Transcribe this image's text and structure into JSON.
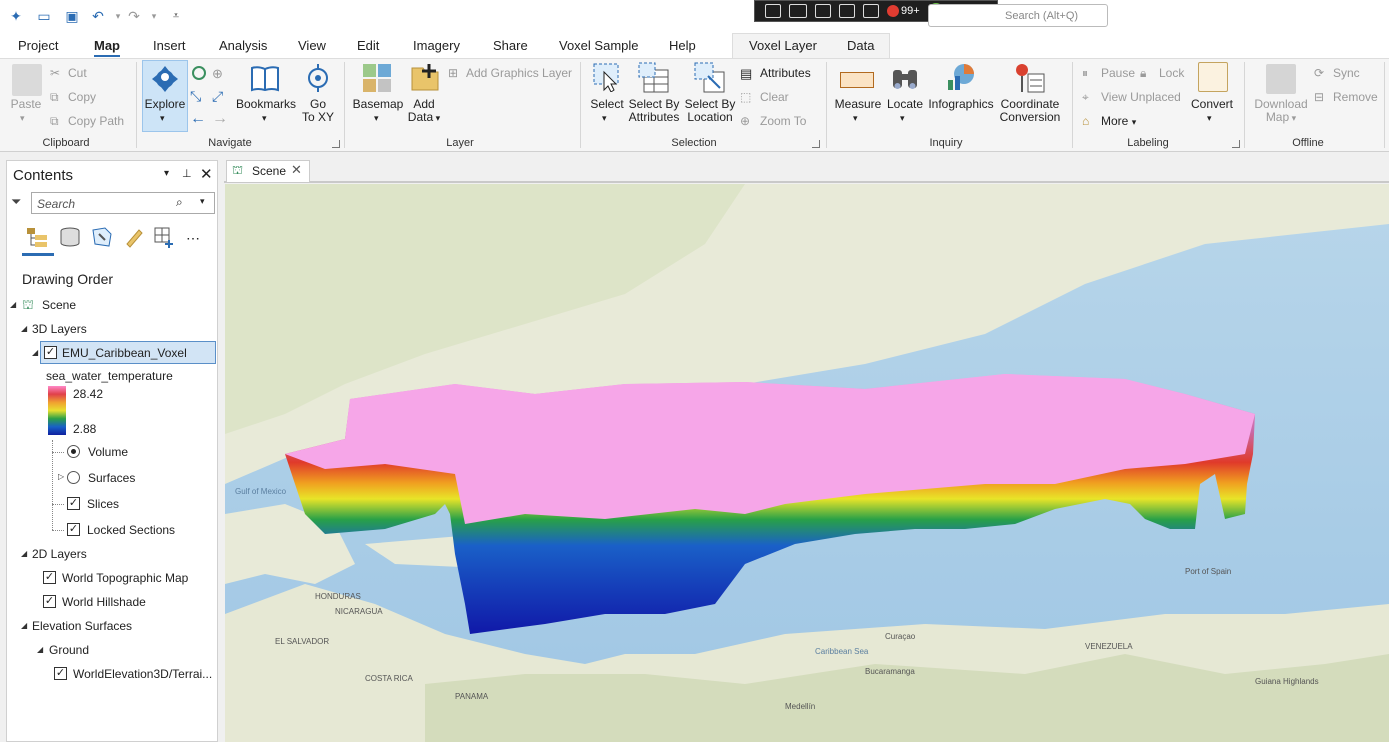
{
  "command_search": {
    "placeholder": "Search (Alt+Q)"
  },
  "status": {
    "notifications": "99+"
  },
  "tabs": [
    "Project",
    "Map",
    "Insert",
    "Analysis",
    "View",
    "Edit",
    "Imagery",
    "Share",
    "Voxel Sample",
    "Help"
  ],
  "context_tabs": [
    "Voxel Layer",
    "Data"
  ],
  "ribbon": {
    "clipboard": {
      "label": "Clipboard",
      "paste": "Paste",
      "cut": "Cut",
      "copy": "Copy",
      "copy_path": "Copy Path"
    },
    "navigate": {
      "label": "Navigate",
      "explore": "Explore",
      "bookmarks": "Bookmarks",
      "goto_xy_1": "Go",
      "goto_xy_2": "To XY"
    },
    "layer": {
      "label": "Layer",
      "basemap": "Basemap",
      "add_data_1": "Add",
      "add_data_2": "Data",
      "add_graphics": "Add Graphics Layer"
    },
    "selection": {
      "label": "Selection",
      "select": "Select",
      "select_by_attr_1": "Select By",
      "select_by_attr_2": "Attributes",
      "select_by_loc_1": "Select By",
      "select_by_loc_2": "Location",
      "attributes": "Attributes",
      "clear": "Clear",
      "zoom_to": "Zoom To"
    },
    "inquiry": {
      "label": "Inquiry",
      "measure": "Measure",
      "locate": "Locate",
      "infographics": "Infographics",
      "coord_1": "Coordinate",
      "coord_2": "Conversion"
    },
    "labeling": {
      "label": "Labeling",
      "pause": "Pause",
      "lock": "Lock",
      "view_unplaced": "View Unplaced",
      "more": "More",
      "convert": "Convert"
    },
    "offline": {
      "label": "Offline",
      "download_1": "Download",
      "download_2": "Map",
      "sync": "Sync",
      "remove": "Remove"
    }
  },
  "contents": {
    "title": "Contents",
    "search_placeholder": "Search",
    "drawing_order": "Drawing Order",
    "scene": "Scene",
    "layers_3d": "3D Layers",
    "voxel_layer": "EMU_Caribbean_Voxel",
    "variable": "sea_water_temperature",
    "legend_max": "28.42",
    "legend_min": "2.88",
    "volume": "Volume",
    "surfaces": "Surfaces",
    "slices": "Slices",
    "locked_sections": "Locked Sections",
    "layers_2d": "2D Layers",
    "topo": "World Topographic Map",
    "hillshade": "World Hillshade",
    "elevation": "Elevation Surfaces",
    "ground": "Ground",
    "terrain": "WorldElevation3D/Terrai..."
  },
  "map_tab": "Scene",
  "map_labels": [
    {
      "text": "Gulf of Mexico"
    },
    {
      "text": "Caribbean Sea"
    },
    {
      "text": "NICARAGUA"
    },
    {
      "text": "HONDURAS"
    },
    {
      "text": "COSTA RICA"
    },
    {
      "text": "PANAMA"
    },
    {
      "text": "VENEZUELA"
    },
    {
      "text": "Guiana Highlands"
    },
    {
      "text": "Medellín"
    },
    {
      "text": "Bucaramanga"
    },
    {
      "text": "EL SALVADOR"
    },
    {
      "text": "Port of Spain"
    },
    {
      "text": "Curaçao"
    }
  ]
}
